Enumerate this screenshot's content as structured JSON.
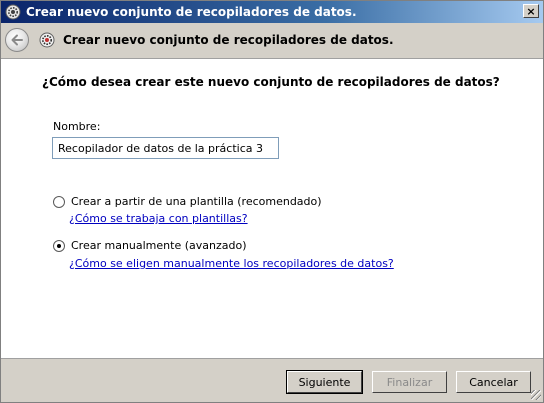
{
  "window": {
    "title": "Crear nuevo conjunto de recopiladores de datos.",
    "close_label": "×"
  },
  "header": {
    "title": "Crear nuevo conjunto de recopiladores de datos."
  },
  "main": {
    "question": "¿Cómo desea crear este nuevo conjunto de recopiladores de datos?",
    "name_label": "Nombre:",
    "name_value": "Recopilador de datos de la práctica 3",
    "options": [
      {
        "label": "Crear a partir de una plantilla (recomendado)",
        "checked": false,
        "help_link": "¿Cómo se trabaja con plantillas?"
      },
      {
        "label": "Crear manualmente (avanzado)",
        "checked": true,
        "help_link": "¿Cómo se eligen manualmente los recopiladores de datos?"
      }
    ]
  },
  "footer": {
    "next_label": "Siguiente",
    "finish_label": "Finalizar",
    "cancel_label": "Cancelar"
  },
  "icons": {
    "window": "gear-icon",
    "back": "back-arrow-icon",
    "wizard": "gear-icon"
  },
  "colors": {
    "titlebar_start": "#0a246a",
    "link": "#0000c0"
  }
}
